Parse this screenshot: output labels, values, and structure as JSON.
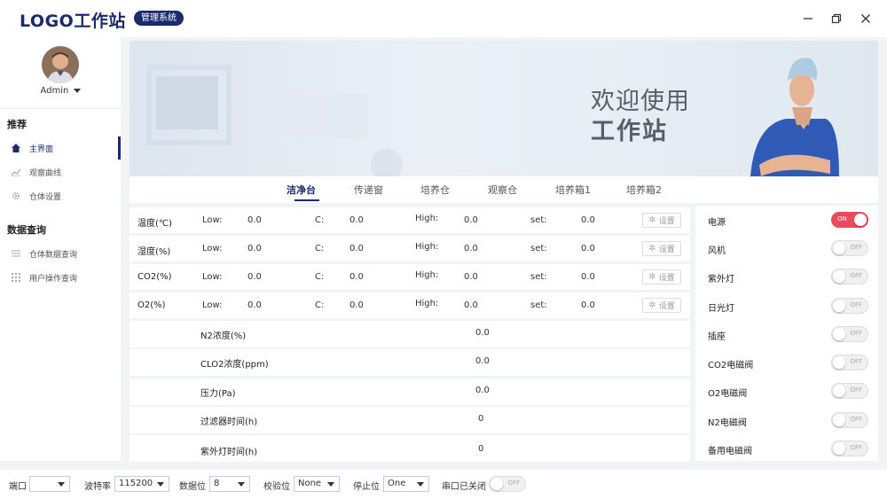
{
  "header": {
    "logo": "LOGO工作站",
    "badge": "管理系统"
  },
  "sidebar": {
    "user": "Admin",
    "group1": "推荐",
    "group2": "数据查询",
    "items": [
      {
        "label": "主界面"
      },
      {
        "label": "观察曲线"
      },
      {
        "label": "仓体设置"
      },
      {
        "label": "仓体数据查询"
      },
      {
        "label": "用户操作查询"
      }
    ]
  },
  "banner": {
    "line1": "欢迎使用",
    "line2": "工作站"
  },
  "tabs": [
    "洁净台",
    "传递窗",
    "培养仓",
    "观察仓",
    "培养箱1",
    "培养箱2"
  ],
  "sensor_labels": {
    "low": "Low:",
    "c": "C:",
    "high": "High:",
    "set": "set:",
    "button": "设置"
  },
  "sensors": [
    {
      "name": "温度(℃)",
      "low": "0.0",
      "c": "0.0",
      "high": "0.0",
      "set": "0.0"
    },
    {
      "name": "湿度(%)",
      "low": "0.0",
      "c": "0.0",
      "high": "0.0",
      "set": "0.0"
    },
    {
      "name": "CO2(%)",
      "low": "0.0",
      "c": "0.0",
      "high": "0.0",
      "set": "0.0"
    },
    {
      "name": "O2(%)",
      "low": "0.0",
      "c": "0.0",
      "high": "0.0",
      "set": "0.0"
    }
  ],
  "readings": [
    {
      "name": "N2浓度(%)",
      "value": "0.0"
    },
    {
      "name": "CLO2浓度(ppm)",
      "value": "0.0"
    },
    {
      "name": "压力(Pa)",
      "value": "0.0"
    },
    {
      "name": "过滤器时间(h)",
      "value": "0"
    },
    {
      "name": "紫外灯时间(h)",
      "value": "0"
    }
  ],
  "switches": [
    {
      "label": "电源",
      "state": "ON"
    },
    {
      "label": "风机",
      "state": "OFF"
    },
    {
      "label": "紫外灯",
      "state": "OFF"
    },
    {
      "label": "日光灯",
      "state": "OFF"
    },
    {
      "label": "插座",
      "state": "OFF"
    },
    {
      "label": "CO2电磁阀",
      "state": "OFF"
    },
    {
      "label": "O2电磁阀",
      "state": "OFF"
    },
    {
      "label": "N2电磁阀",
      "state": "OFF"
    },
    {
      "label": "备用电磁阀",
      "state": "OFF"
    }
  ],
  "serial": {
    "port_label": "端口",
    "port_value": "",
    "baud_label": "波特率",
    "baud_value": "115200",
    "databits_label": "数据位",
    "databits_value": "8",
    "parity_label": "校验位",
    "parity_value": "None",
    "stopbits_label": "停止位",
    "stopbits_value": "One",
    "status_label": "串口已关闭",
    "status_toggle": "OFF"
  },
  "colors": {
    "brand": "#1a2a6c",
    "toggle_on": "#e94a5c"
  }
}
